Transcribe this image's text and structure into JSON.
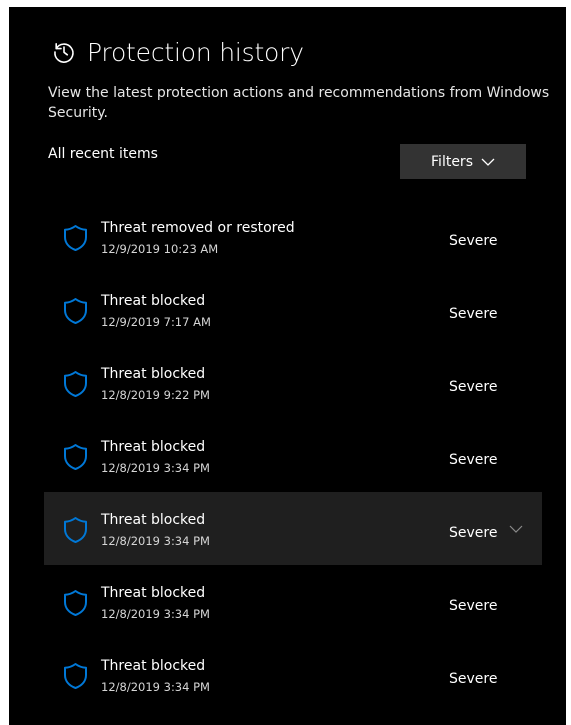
{
  "page": {
    "title": "Protection history",
    "description": "View the latest protection actions and recommendations from Windows Security.",
    "section_label": "All recent items",
    "filters_label": "Filters"
  },
  "icons": {
    "header": "history-icon",
    "row": "shield-icon",
    "filters": "chevron-down-icon",
    "expand": "chevron-down-icon"
  },
  "colors": {
    "background": "#000000",
    "accent": "#0078d7",
    "selected_row": "#1f1f1f",
    "button": "#333333"
  },
  "items": [
    {
      "title": "Threat removed or restored",
      "time": "12/9/2019 10:23 AM",
      "severity": "Severe"
    },
    {
      "title": "Threat blocked",
      "time": "12/9/2019 7:17 AM",
      "severity": "Severe"
    },
    {
      "title": "Threat blocked",
      "time": "12/8/2019 9:22 PM",
      "severity": "Severe"
    },
    {
      "title": "Threat blocked",
      "time": "12/8/2019 3:34 PM",
      "severity": "Severe"
    },
    {
      "title": "Threat blocked",
      "time": "12/8/2019 3:34 PM",
      "severity": "Severe",
      "selected": true
    },
    {
      "title": "Threat blocked",
      "time": "12/8/2019 3:34 PM",
      "severity": "Severe"
    },
    {
      "title": "Threat blocked",
      "time": "12/8/2019 3:34 PM",
      "severity": "Severe"
    }
  ]
}
